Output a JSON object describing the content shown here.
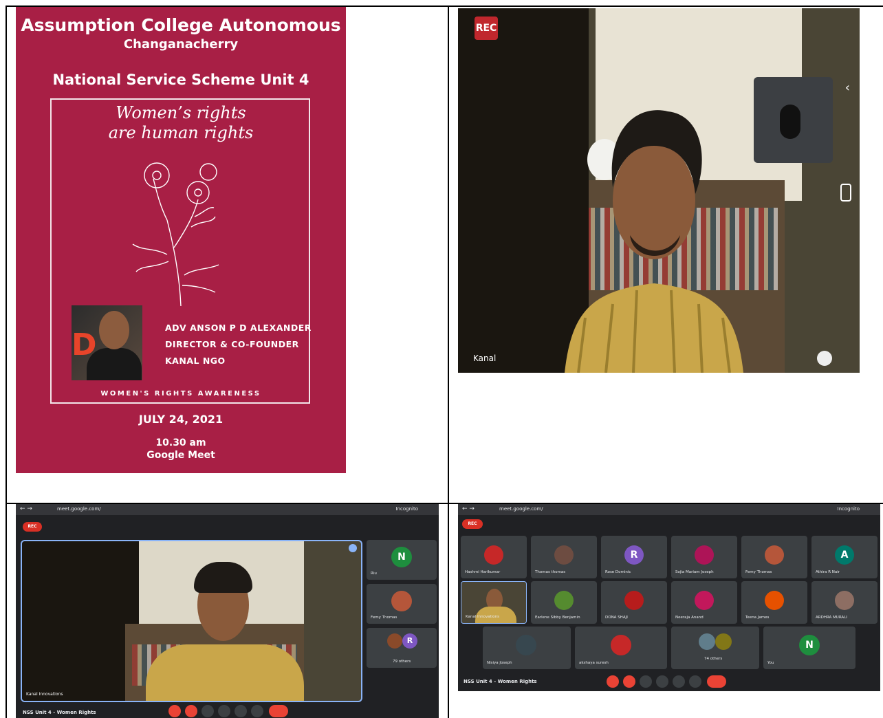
{
  "poster": {
    "college": "Assumption College Autonomous",
    "place": "Changanacherry",
    "unit": "National Service Scheme Unit 4",
    "theme_line1": "Women’s rights",
    "theme_line2": "are human rights",
    "speaker_line1": "ADV ANSON P D ALEXANDER",
    "speaker_line2": "DIRECTOR & CO-FOUNDER",
    "speaker_line3": "KANAL NGO",
    "logo_letter": "D",
    "awareness": "WOMEN'S RIGHTS AWARENESS",
    "date": "JULY 24, 2021",
    "time": "10.30 am",
    "platform": "Google Meet",
    "color_bg": "#a81f45"
  },
  "video_main": {
    "rec_label": "REC",
    "name_label": "Kanal"
  },
  "meet_left": {
    "url": "meet.google.com/",
    "profile": "Incognito",
    "rec_label": "REC",
    "speaker_label": "Kanal Innovations",
    "meeting_title": "NSS Unit 4 - Women Rights",
    "side_tiles": [
      {
        "initial": "N",
        "label": "Riu"
      },
      {
        "initial": "",
        "label": "Femy Thomas"
      },
      {
        "initial": "R",
        "label": "79 others"
      }
    ]
  },
  "meet_right": {
    "url": "meet.google.com/",
    "profile": "Incognito",
    "rec_label": "REC",
    "meeting_title": "NSS Unit 4 - Women Rights",
    "row1": [
      {
        "initial": "",
        "label": "Hashmi Harikumar"
      },
      {
        "initial": "",
        "label": "Thomas thomas"
      },
      {
        "initial": "R",
        "label": "Rose Dominic"
      },
      {
        "initial": "",
        "label": "Sojia Mariam Joseph"
      },
      {
        "initial": "",
        "label": "Femy Thomas"
      },
      {
        "initial": "A",
        "label": "Athira R Nair"
      }
    ],
    "row2": [
      {
        "initial": "",
        "label": "Kanal Innovations"
      },
      {
        "initial": "",
        "label": "Earlene Sibby Benjamin"
      },
      {
        "initial": "",
        "label": "DONA SHAJI"
      },
      {
        "initial": "",
        "label": "Neeraja Anand"
      },
      {
        "initial": "",
        "label": "Teena James"
      },
      {
        "initial": "",
        "label": "ARDHRA MURALI"
      }
    ],
    "row3": [
      {
        "initial": "",
        "label": "Nisiya Joseph"
      },
      {
        "initial": "",
        "label": "akshaya suresh"
      },
      {
        "initial": "",
        "label": "74 others"
      },
      {
        "initial": "N",
        "label": "You"
      }
    ]
  }
}
